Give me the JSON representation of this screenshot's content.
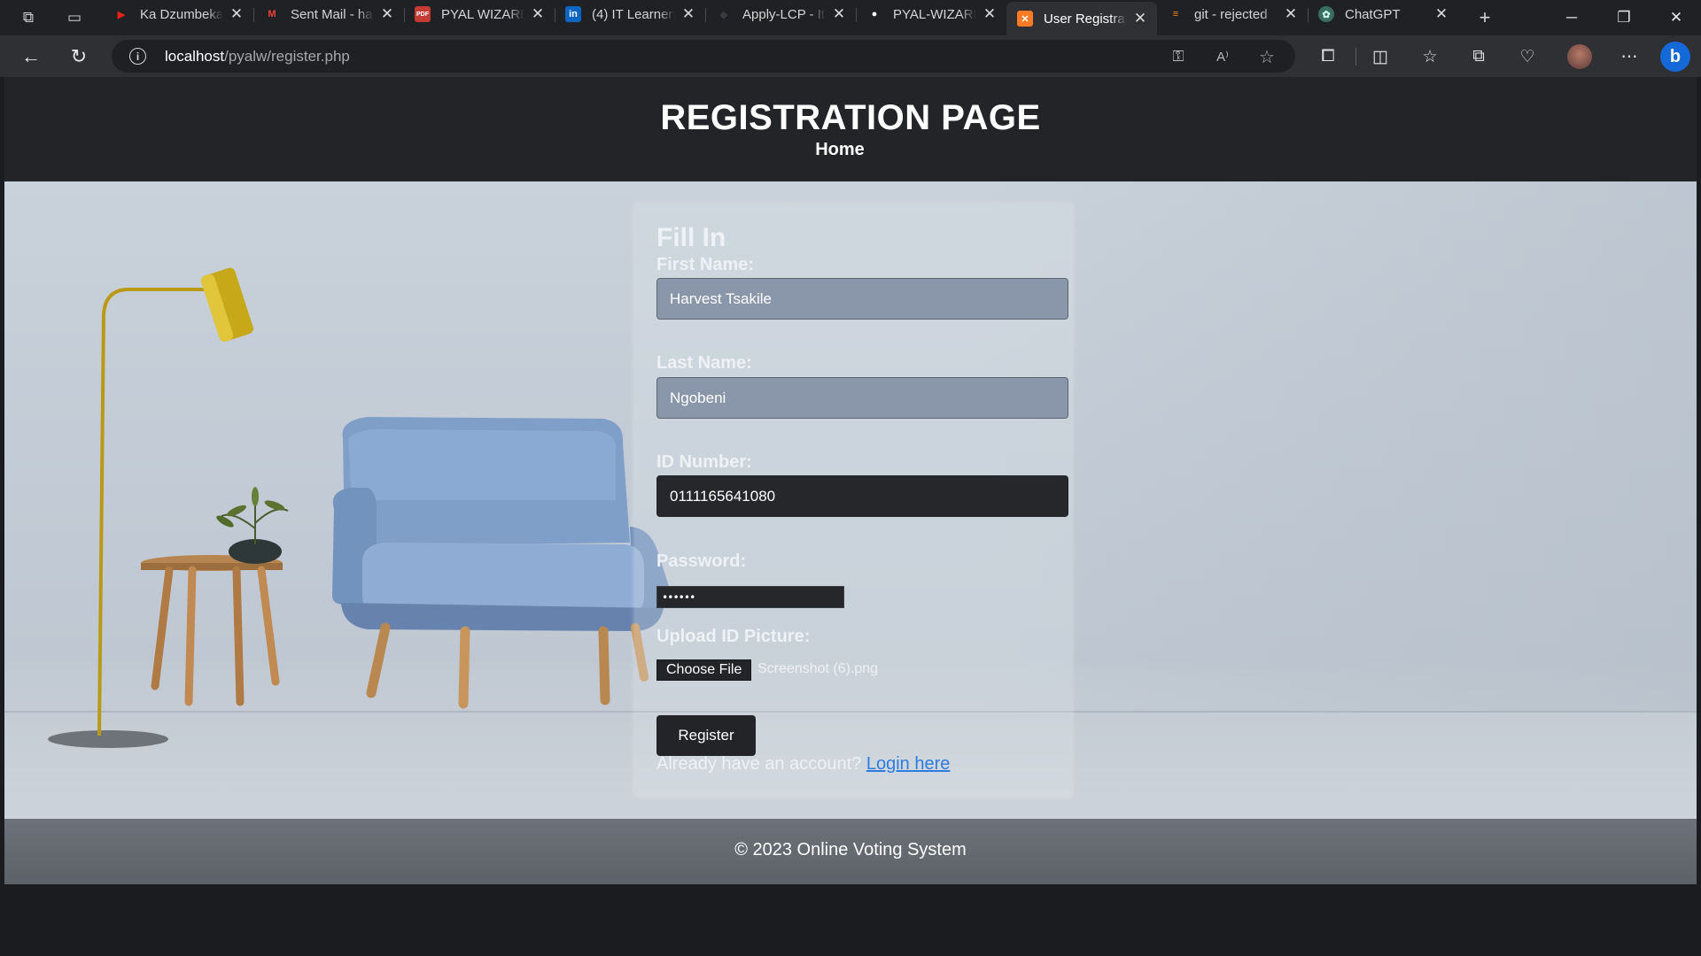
{
  "browser": {
    "tabs": [
      {
        "title": "Ka Dzumbeka",
        "favicon": "youtube-icon",
        "color": "#e62117",
        "active": false
      },
      {
        "title": "Sent Mail - ha",
        "favicon": "gmail-icon",
        "color": "#ea4335",
        "active": false
      },
      {
        "title": "PYAL WIZARD",
        "favicon": "pdf-icon",
        "color": "#c43b35",
        "active": false
      },
      {
        "title": "(4) IT Learners",
        "favicon": "linkedin-icon",
        "color": "#0a66c2",
        "active": false
      },
      {
        "title": "Apply-LCP - It",
        "favicon": "site-icon",
        "color": "#3b3b3b",
        "active": false
      },
      {
        "title": "PYAL-WIZARD",
        "favicon": "github-icon",
        "color": "#ffffff",
        "active": false
      },
      {
        "title": "User Registrat",
        "favicon": "xampp-icon",
        "color": "#fb7a24",
        "active": true
      },
      {
        "title": "git - rejected",
        "favicon": "stackoverflow-icon",
        "color": "#f48024",
        "active": false
      },
      {
        "title": "ChatGPT",
        "favicon": "chatgpt-icon",
        "color": "#10a37f",
        "active": false
      }
    ],
    "url_host": "localhost",
    "url_path": "/pyalw/register.php"
  },
  "header": {
    "title": "REGISTRATION PAGE",
    "home_link": "Home"
  },
  "form": {
    "heading": "Fill In",
    "first_name_label": "First Name:",
    "first_name_value": "Harvest Tsakile",
    "last_name_label": "Last Name:",
    "last_name_value": "Ngobeni",
    "id_label": "ID Number:",
    "id_value": "0111165641080",
    "password_label": "Password:",
    "password_value": "••••••",
    "upload_label": "Upload ID Picture:",
    "choose_file_label": "Choose File",
    "file_name": "Screenshot (6).png",
    "register_button": "Register",
    "account_prompt": "Already have an account?",
    "login_link": "Login here"
  },
  "footer": {
    "text": "© 2023 Online Voting System"
  }
}
